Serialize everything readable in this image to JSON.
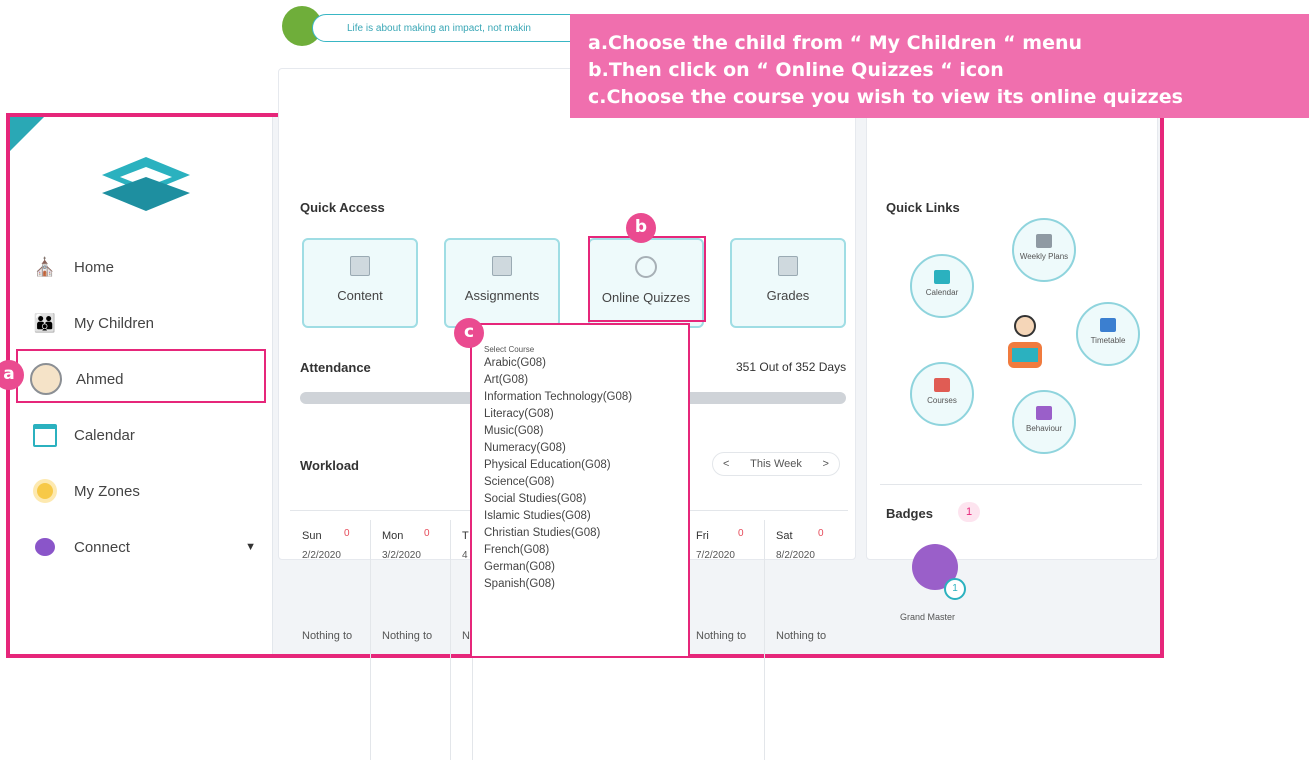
{
  "banner": {
    "line_a": "a.Choose the child from “ My Children “ menu",
    "line_b": "b.Then click on “ Online Quizzes “ icon",
    "line_c": "c.Choose the course you wish to view its online quizzes"
  },
  "header": {
    "quote": "Life is about making an impact, not makin"
  },
  "sidebar": {
    "items": [
      {
        "label": "Home",
        "icon": "home-icon"
      },
      {
        "label": "My Children",
        "icon": "children-icon"
      },
      {
        "label": "Ahmed",
        "icon": "child-avatar-icon"
      },
      {
        "label": "Calendar",
        "icon": "calendar-icon"
      },
      {
        "label": "My Zones",
        "icon": "zones-icon"
      },
      {
        "label": "Connect",
        "icon": "connect-icon"
      }
    ]
  },
  "quick_access": {
    "title": "Quick Access",
    "tiles": [
      "Content",
      "Assignments",
      "Online Quizzes",
      "Grades"
    ]
  },
  "attendance": {
    "title": "Attendance",
    "summary": "351 Out of 352 Days"
  },
  "workload": {
    "title": "Workload",
    "week_label": "This Week",
    "prev": "<",
    "next": ">",
    "days": [
      {
        "name": "Sun",
        "count": "0",
        "date": "2/2/2020",
        "text": "Nothing to"
      },
      {
        "name": "Mon",
        "count": "0",
        "date": "3/2/2020",
        "text": "Nothing to"
      },
      {
        "name": "T",
        "count": "",
        "date": "4",
        "text": "N"
      },
      {
        "name": "Fri",
        "count": "0",
        "date": "7/2/2020",
        "text": "Nothing to"
      },
      {
        "name": "Sat",
        "count": "0",
        "date": "8/2/2020",
        "text": "Nothing to"
      }
    ]
  },
  "quick_links": {
    "title": "Quick Links",
    "items": [
      "Calendar",
      "Weekly Plans",
      "Timetable",
      "Courses",
      "Behaviour"
    ]
  },
  "badges": {
    "title": "Badges",
    "count": "1",
    "badge_name": "Grand Master",
    "badge_level": "1"
  },
  "course_select": {
    "label": "Select Course",
    "options": [
      "Arabic(G08)",
      "Art(G08)",
      "Information Technology(G08)",
      "Literacy(G08)",
      "Music(G08)",
      "Numeracy(G08)",
      "Physical Education(G08)",
      "Science(G08)",
      "Social Studies(G08)",
      "Islamic Studies(G08)",
      "Christian Studies(G08)",
      "French(G08)",
      "German(G08)",
      "Spanish(G08)"
    ]
  },
  "callouts": {
    "a": "a",
    "b": "b",
    "c": "c"
  },
  "colors": {
    "highlight": "#e6267a",
    "banner": "#f06fae",
    "accent": "#2aa8b5"
  }
}
